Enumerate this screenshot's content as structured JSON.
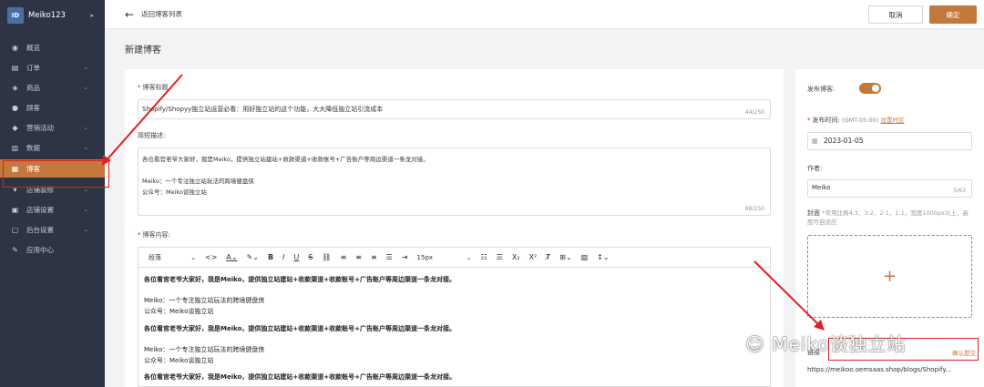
{
  "sidebar": {
    "brand": "Meiko123",
    "brand_logo": "ID",
    "items": [
      {
        "label": "概览",
        "icon": "dashboard-icon",
        "glyph": "◉",
        "chev": ""
      },
      {
        "label": "订单",
        "icon": "order-icon",
        "glyph": "▤",
        "chev": "⌄"
      },
      {
        "label": "商品",
        "icon": "product-icon",
        "glyph": "◈",
        "chev": "⌄"
      },
      {
        "label": "顾客",
        "icon": "user-icon",
        "glyph": "●",
        "chev": ""
      },
      {
        "label": "营销活动",
        "icon": "tag-icon",
        "glyph": "◆",
        "chev": "⌄"
      },
      {
        "label": "数据",
        "icon": "chart-icon",
        "glyph": "▥",
        "chev": "⌄"
      },
      {
        "label": "博客",
        "icon": "blog-icon",
        "glyph": "▦",
        "chev": ""
      },
      {
        "label": "店铺装修",
        "icon": "brush-icon",
        "glyph": "▾",
        "chev": "⌄"
      },
      {
        "label": "店铺设置",
        "icon": "store-icon",
        "glyph": "▣",
        "chev": "⌄"
      },
      {
        "label": "后台设置",
        "icon": "settings-icon",
        "glyph": "▢",
        "chev": "⌄"
      },
      {
        "label": "应用中心",
        "icon": "wrench-icon",
        "glyph": "✎",
        "chev": ""
      }
    ]
  },
  "topbar": {
    "back_label": "返回博客列表",
    "cancel": "取消",
    "ok": "确定"
  },
  "page_title": "新建博客",
  "form": {
    "title_label": "博客标题",
    "title_value": "Shopify/Shopyy独立站运营必看：用好独立站的这个功能，大大降低独立站引流成本",
    "title_count": "44/250",
    "desc_label": "简短描述:",
    "desc_lines": [
      "各位看官老爷大家好，我是Meiko，提供独立站建站+收款渠道+收款账号+广告账户等周边渠道一条龙对接。",
      "",
      "Meiko：一个专注独立站玩法的跨境健盘侠",
      "公众号：Meiko谈独立站"
    ],
    "desc_count": "88/250",
    "content_label": "博客内容:",
    "toolbar": {
      "paragraph": "段落",
      "size": "15px"
    },
    "editor_lines": [
      {
        "text": "各位看官老爷大家好，我是Meiko，提供独立站建站+收款渠道+收款账号+广告账户等周边渠道一条龙对接。",
        "bold": true
      },
      {
        "text": "Meiko：一个专注独立站玩法的跨境健盘侠",
        "bold": false
      },
      {
        "text": "公众号：Meiko谈独立站",
        "bold": false
      },
      {
        "text": "各位看官老爷大家好，我是Meiko，提供独立站建站+收款渠道+收款账号+广告账户等周边渠道一条龙对接。",
        "bold": true
      },
      {
        "text": "Meiko：一个专注独立站玩法的跨境健盘侠",
        "bold": false
      },
      {
        "text": "公众号：Meiko谈独立站",
        "bold": false
      },
      {
        "text": "各位看官老爷大家好，我是Meiko，提供独立站建站+收款渠道+收款账号+广告账户等周边渠道一条龙对接。",
        "bold": true
      }
    ]
  },
  "side": {
    "publish_label": "发布博客:",
    "publish_on": true,
    "time_label": "发布时间:",
    "time_zone": "(GMT-05:00)",
    "time_link": "设置时区",
    "date_value": "2023-01-05",
    "author_label": "作者:",
    "author_value": "Meiko",
    "author_count": "5/63",
    "cover_label": "封面",
    "cover_hint": "*常用比例4:3、3:2、2:1、1:1，宽度1000px以上，高度可自适应",
    "upload_plus": "+",
    "url_label": "链接",
    "url_hint": "确认提交",
    "url_value": "https://meikoo.oemsaas.shop/blogs/Shopify..."
  },
  "watermark": "Meiko谈独立站",
  "colors": {
    "accent": "#c3793b",
    "sidebar": "#2d3545",
    "highlight": "#e02020"
  }
}
